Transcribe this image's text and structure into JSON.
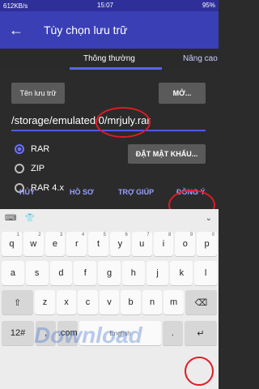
{
  "status": {
    "left": "612KB/s",
    "time": "15:07",
    "battery": "95%"
  },
  "appbar": {
    "back_icon": "arrow-left-icon",
    "title": "Tùy chọn lưu trữ"
  },
  "tabs": [
    {
      "label": "Thông thường"
    },
    {
      "label": "Nâng cao"
    }
  ],
  "buttons": {
    "name": "Tên lưu trữ",
    "open": "MỞ...",
    "password": "ĐẶT MẬT KHẨU..."
  },
  "path": "/storage/emulated/0/mrjuly.rar",
  "formats": [
    {
      "label": "RAR",
      "checked": true
    },
    {
      "label": "ZIP",
      "checked": false
    },
    {
      "label": "RAR 4.x",
      "checked": false
    }
  ],
  "actions": {
    "cancel": "HỦY",
    "profile": "HỒ SƠ",
    "help": "TRỢ GIÚP",
    "ok": "ĐỒNG Ý"
  },
  "keyboard": {
    "row1": [
      {
        "k": "q",
        "s": "1"
      },
      {
        "k": "w",
        "s": "2"
      },
      {
        "k": "e",
        "s": "3"
      },
      {
        "k": "r",
        "s": "4"
      },
      {
        "k": "t",
        "s": "5"
      },
      {
        "k": "y",
        "s": "6"
      },
      {
        "k": "u",
        "s": "7"
      },
      {
        "k": "i",
        "s": "8"
      },
      {
        "k": "o",
        "s": "9"
      },
      {
        "k": "p",
        "s": "0"
      }
    ],
    "row2": [
      "a",
      "s",
      "d",
      "f",
      "g",
      "h",
      "j",
      "k",
      "l"
    ],
    "row3": [
      "z",
      "x",
      "c",
      "v",
      "b",
      "n",
      "m"
    ],
    "bottom": {
      "sym": "12#",
      "comma": ",",
      "dotcom": ".com",
      "lang": "English",
      "period": ".",
      "enter": "↵"
    },
    "shift": "⇧",
    "backspace": "⌫"
  },
  "watermark": "Download"
}
